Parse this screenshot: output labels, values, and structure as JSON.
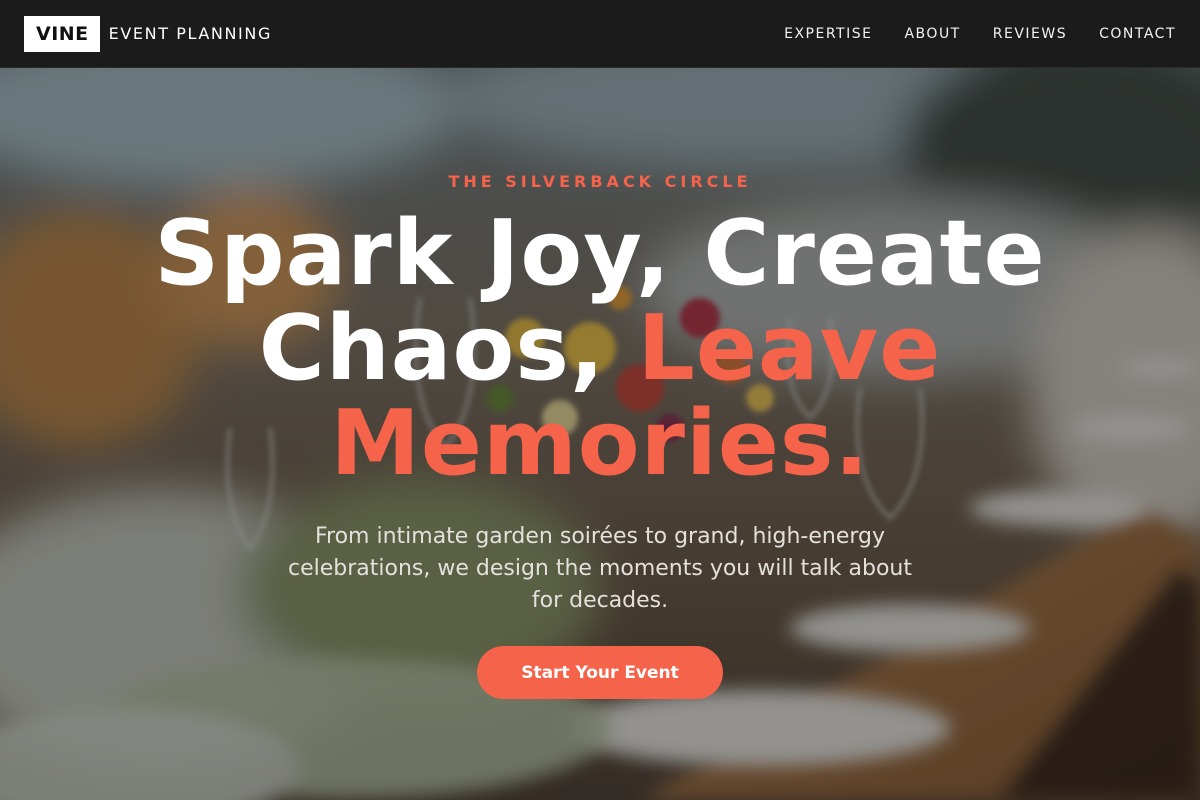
{
  "nav": {
    "logo_mark": "VINE",
    "logo_text": "EVENT PLANNING",
    "links": [
      "EXPERTISE",
      "ABOUT",
      "REVIEWS",
      "CONTACT"
    ]
  },
  "hero": {
    "background": "blurred banquet table with flowers and glassware",
    "eyebrow": "THE SILVERBACK CIRCLE",
    "headline_line1": "Spark Joy, Create",
    "headline_line2_white": "Chaos,",
    "headline_line2_accent": "Leave",
    "headline_line3_accent": "Memories.",
    "subtext": "From intimate garden soirées to grand, high-energy celebrations, we design the moments you will talk about for decades.",
    "cta_label": "Start Your Event"
  },
  "colors": {
    "accent": "#f4634a",
    "nav_bg": "#1b1b1b",
    "logo_bg": "#ffffff"
  }
}
